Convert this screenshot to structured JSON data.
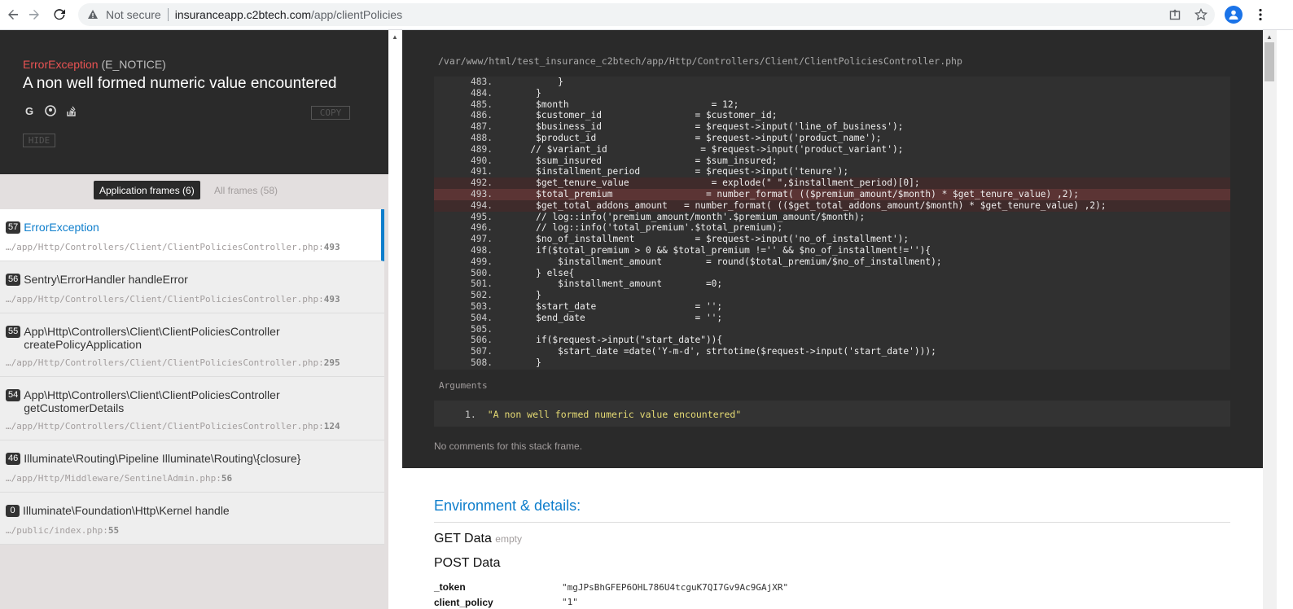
{
  "browser": {
    "security_label": "Not secure",
    "url_host": "insuranceapp.c2btech.com",
    "url_path": "/app/clientPolicies"
  },
  "error": {
    "exception_class": "ErrorException",
    "exception_type": "(E_NOTICE)",
    "message": "A non well formed numeric value encountered",
    "copy_label": "COPY",
    "hide_label": "HIDE"
  },
  "filters": {
    "application": "Application frames (6)",
    "all": "All frames (58)"
  },
  "frames": [
    {
      "num": "57",
      "title": "ErrorException",
      "title2": "",
      "path": "…/app/Http/Controllers/Client/ClientPoliciesController.php",
      "line": "493",
      "active": true
    },
    {
      "num": "56",
      "title": "Sentry\\ErrorHandler handleError",
      "title2": "",
      "path": "…/app/Http/Controllers/Client/ClientPoliciesController.php",
      "line": "493",
      "active": false
    },
    {
      "num": "55",
      "title": "App\\Http\\Controllers\\Client\\ClientPoliciesController",
      "title2": "createPolicyApplication",
      "path": "…/app/Http/Controllers/Client/ClientPoliciesController.php",
      "line": "295",
      "active": false
    },
    {
      "num": "54",
      "title": "App\\Http\\Controllers\\Client\\ClientPoliciesController",
      "title2": "getCustomerDetails",
      "path": "…/app/Http/Controllers/Client/ClientPoliciesController.php",
      "line": "124",
      "active": false
    },
    {
      "num": "46",
      "title": "Illuminate\\Routing\\Pipeline Illuminate\\Routing\\{closure}",
      "title2": "",
      "path": "…/app/Http/Middleware/SentinelAdmin.php",
      "line": "56",
      "active": false
    },
    {
      "num": "0",
      "title": "Illuminate\\Foundation\\Http\\Kernel handle",
      "title2": "",
      "path": "…/public/index.php",
      "line": "55",
      "active": false
    }
  ],
  "code": {
    "file_path": "/var/www/html/test_insurance_c2btech/app/Http/Controllers/Client/ClientPoliciesController.php",
    "lines": [
      {
        "n": "483.",
        "t": "           }"
      },
      {
        "n": "484.",
        "t": "       }"
      },
      {
        "n": "485.",
        "t": "       $month                          = 12;"
      },
      {
        "n": "486.",
        "t": "       $customer_id                 = $customer_id;"
      },
      {
        "n": "487.",
        "t": "       $business_id                 = $request->input('line_of_business');"
      },
      {
        "n": "488.",
        "t": "       $product_id                  = $request->input('product_name');"
      },
      {
        "n": "489.",
        "t": "      // $variant_id                 = $request->input('product_variant');"
      },
      {
        "n": "490.",
        "t": "       $sum_insured                 = $sum_insured;"
      },
      {
        "n": "491.",
        "t": "       $installment_period          = $request->input('tenure');"
      },
      {
        "n": "492.",
        "t": "       $get_tenure_value               = explode(\" \",$installment_period)[0];"
      },
      {
        "n": "493.",
        "t": "       $total_premium                 = number_format( (($premium_amount/$month) * $get_tenure_value) ,2);"
      },
      {
        "n": "494.",
        "t": "       $get_total_addons_amount   = number_format( (($get_total_addons_amount/$month) * $get_tenure_value) ,2);"
      },
      {
        "n": "495.",
        "t": "       // log::info('premium_amount/month'.$premium_amount/$month);"
      },
      {
        "n": "496.",
        "t": "       // log::info('total_premium'.$total_premium);"
      },
      {
        "n": "497.",
        "t": "       $no_of_installment           = $request->input('no_of_installment');"
      },
      {
        "n": "498.",
        "t": "       if($total_premium > 0 && $total_premium !='' && $no_of_installment!=''){"
      },
      {
        "n": "499.",
        "t": "           $installment_amount        = round($total_premium/$no_of_installment);"
      },
      {
        "n": "500.",
        "t": "       } else{"
      },
      {
        "n": "501.",
        "t": "           $installment_amount        =0;"
      },
      {
        "n": "502.",
        "t": "       }"
      },
      {
        "n": "503.",
        "t": "       $start_date                  = '';"
      },
      {
        "n": "504.",
        "t": "       $end_date                    = '';"
      },
      {
        "n": "505.",
        "t": ""
      },
      {
        "n": "506.",
        "t": "       if($request->input(\"start_date\")){"
      },
      {
        "n": "507.",
        "t": "           $start_date =date('Y-m-d', strtotime($request->input('start_date')));"
      },
      {
        "n": "508.",
        "t": "       }"
      }
    ],
    "highlight_lines": [
      "492.",
      "493.",
      "494."
    ],
    "error_line": "493."
  },
  "arguments": {
    "label": "Arguments",
    "items": [
      "\"A non well formed numeric value encountered\""
    ],
    "comments": "No comments for this stack frame."
  },
  "env": {
    "title": "Environment & details:",
    "get_label": "GET Data",
    "get_empty": "empty",
    "post_label": "POST Data",
    "rows": [
      {
        "key": "_token",
        "value": "\"mgJPsBhGFEP6OHL786U4tcguK7QI7Gv9Ac9GAjXR\""
      },
      {
        "key": "client_policy",
        "value": "\"1\""
      }
    ]
  }
}
